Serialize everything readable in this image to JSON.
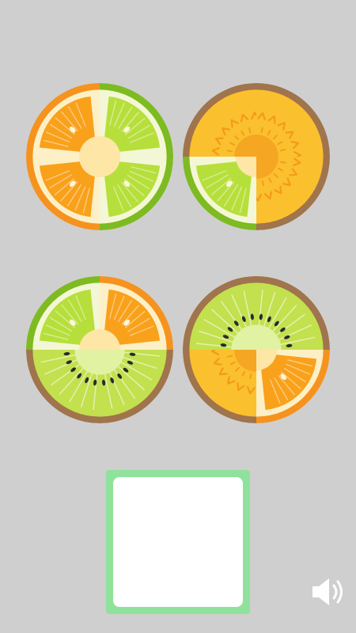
{
  "game": {
    "tiles": [
      {
        "name": "tile-orange-lime",
        "quadrants": [
          "orange",
          "lime",
          "orange",
          "lime"
        ]
      },
      {
        "name": "tile-passion-lime",
        "quadrants": [
          "passion",
          "passion",
          "lime",
          "passion"
        ]
      },
      {
        "name": "tile-lime-kiwi",
        "quadrants": [
          "lime",
          "orange",
          "kiwi",
          "kiwi"
        ]
      },
      {
        "name": "tile-kiwi-orange",
        "quadrants": [
          "kiwi",
          "kiwi",
          "passion",
          "orange"
        ]
      }
    ],
    "answer_box": {
      "state": "empty"
    },
    "sound": {
      "icon": "speaker-icon",
      "state": "on"
    }
  },
  "colors": {
    "background": "#cfcfcf",
    "orange_rind": "#f5931e",
    "orange_flesh": "#f9a11b",
    "lime_rind": "#7dbb21",
    "lime_flesh": "#b6df3b",
    "kiwi_rind": "#a0744c",
    "kiwi_flesh": "#c3e04f",
    "passion_rind": "#a0744c",
    "passion_flesh": "#fbc02d",
    "answer_border": "#8fe29b"
  }
}
